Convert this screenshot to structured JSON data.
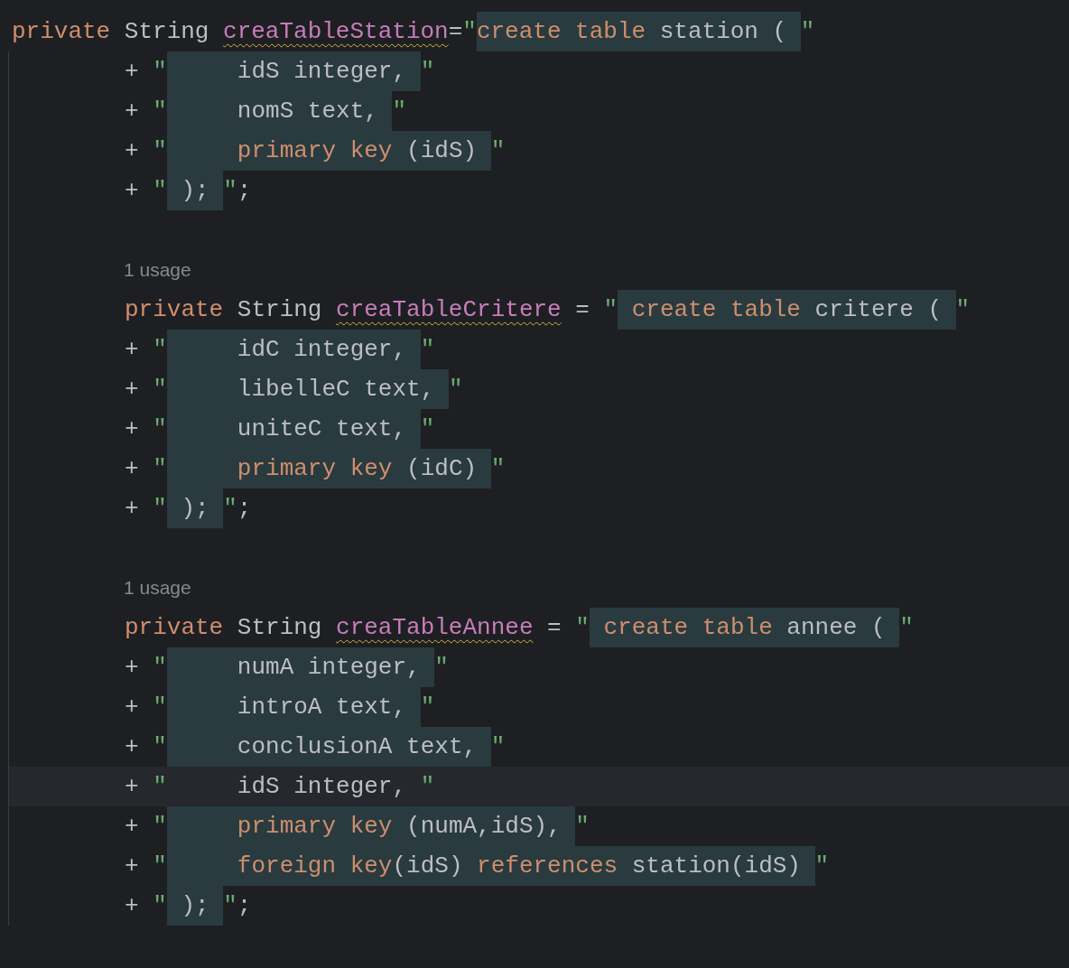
{
  "top_line": {
    "tokens": [
      {
        "text": "private",
        "kind": "keyword",
        "injected": false
      },
      {
        "text": " String ",
        "kind": "plain",
        "injected": false
      },
      {
        "text": "creaTableStation",
        "kind": "field",
        "warning": true,
        "injected": false
      },
      {
        "text": "=",
        "kind": "plain",
        "injected": false
      },
      {
        "text": "\"",
        "kind": "quote",
        "injected": false
      },
      {
        "text": "create table",
        "kind": "keyword",
        "injected": true
      },
      {
        "text": " station ( ",
        "kind": "plain",
        "injected": true
      },
      {
        "text": "\"",
        "kind": "quote",
        "injected": false
      }
    ]
  },
  "lines": [
    {
      "kind": "code",
      "tokens": [
        {
          "text": "+ ",
          "kind": "plain",
          "injected": false
        },
        {
          "text": "\"",
          "kind": "quote",
          "injected": false
        },
        {
          "text": "     idS integer, ",
          "kind": "plain",
          "injected": true
        },
        {
          "text": "\"",
          "kind": "quote",
          "injected": false
        }
      ]
    },
    {
      "kind": "code",
      "tokens": [
        {
          "text": "+ ",
          "kind": "plain",
          "injected": false
        },
        {
          "text": "\"",
          "kind": "quote",
          "injected": false
        },
        {
          "text": "     nomS text, ",
          "kind": "plain",
          "injected": true
        },
        {
          "text": "\"",
          "kind": "quote",
          "injected": false
        }
      ]
    },
    {
      "kind": "code",
      "tokens": [
        {
          "text": "+ ",
          "kind": "plain",
          "injected": false
        },
        {
          "text": "\"",
          "kind": "quote",
          "injected": false
        },
        {
          "text": "     primary key",
          "kind": "keyword",
          "injected": true
        },
        {
          "text": " (idS) ",
          "kind": "plain",
          "injected": true
        },
        {
          "text": "\"",
          "kind": "quote",
          "injected": false
        }
      ]
    },
    {
      "kind": "code",
      "tokens": [
        {
          "text": "+ ",
          "kind": "plain",
          "injected": false
        },
        {
          "text": "\"",
          "kind": "quote",
          "injected": false
        },
        {
          "text": " ); ",
          "kind": "plain",
          "injected": true
        },
        {
          "text": "\"",
          "kind": "quote",
          "injected": false
        },
        {
          "text": ";",
          "kind": "plain",
          "injected": false
        }
      ]
    },
    {
      "kind": "usage",
      "text": "1 usage"
    },
    {
      "kind": "code",
      "tokens": [
        {
          "text": "private",
          "kind": "keyword",
          "injected": false
        },
        {
          "text": " String ",
          "kind": "plain",
          "injected": false
        },
        {
          "text": "creaTableCritere",
          "kind": "field",
          "warning": true,
          "injected": false
        },
        {
          "text": " = ",
          "kind": "plain",
          "injected": false
        },
        {
          "text": "\"",
          "kind": "quote",
          "injected": false
        },
        {
          "text": " create table",
          "kind": "keyword",
          "injected": true
        },
        {
          "text": " critere ( ",
          "kind": "plain",
          "injected": true
        },
        {
          "text": "\"",
          "kind": "quote",
          "injected": false
        }
      ]
    },
    {
      "kind": "code",
      "tokens": [
        {
          "text": "+ ",
          "kind": "plain",
          "injected": false
        },
        {
          "text": "\"",
          "kind": "quote",
          "injected": false
        },
        {
          "text": "     idC integer, ",
          "kind": "plain",
          "injected": true
        },
        {
          "text": "\"",
          "kind": "quote",
          "injected": false
        }
      ]
    },
    {
      "kind": "code",
      "tokens": [
        {
          "text": "+ ",
          "kind": "plain",
          "injected": false
        },
        {
          "text": "\"",
          "kind": "quote",
          "injected": false
        },
        {
          "text": "     libelleC text, ",
          "kind": "plain",
          "injected": true
        },
        {
          "text": "\"",
          "kind": "quote",
          "injected": false
        }
      ]
    },
    {
      "kind": "code",
      "tokens": [
        {
          "text": "+ ",
          "kind": "plain",
          "injected": false
        },
        {
          "text": "\"",
          "kind": "quote",
          "injected": false
        },
        {
          "text": "     uniteC text, ",
          "kind": "plain",
          "injected": true
        },
        {
          "text": "\"",
          "kind": "quote",
          "injected": false
        }
      ]
    },
    {
      "kind": "code",
      "tokens": [
        {
          "text": "+ ",
          "kind": "plain",
          "injected": false
        },
        {
          "text": "\"",
          "kind": "quote",
          "injected": false
        },
        {
          "text": "     primary key",
          "kind": "keyword",
          "injected": true
        },
        {
          "text": " (idC) ",
          "kind": "plain",
          "injected": true
        },
        {
          "text": "\"",
          "kind": "quote",
          "injected": false
        }
      ]
    },
    {
      "kind": "code",
      "tokens": [
        {
          "text": "+ ",
          "kind": "plain",
          "injected": false
        },
        {
          "text": "\"",
          "kind": "quote",
          "injected": false
        },
        {
          "text": " ); ",
          "kind": "plain",
          "injected": true
        },
        {
          "text": "\"",
          "kind": "quote",
          "injected": false
        },
        {
          "text": ";",
          "kind": "plain",
          "injected": false
        }
      ]
    },
    {
      "kind": "usage",
      "text": "1 usage"
    },
    {
      "kind": "code",
      "tokens": [
        {
          "text": "private",
          "kind": "keyword",
          "injected": false
        },
        {
          "text": " String ",
          "kind": "plain",
          "injected": false
        },
        {
          "text": "creaTableAnnee",
          "kind": "field",
          "warning": true,
          "injected": false
        },
        {
          "text": " = ",
          "kind": "plain",
          "injected": false
        },
        {
          "text": "\"",
          "kind": "quote",
          "injected": false
        },
        {
          "text": " create table",
          "kind": "keyword",
          "injected": true
        },
        {
          "text": " annee ( ",
          "kind": "plain",
          "injected": true
        },
        {
          "text": "\"",
          "kind": "quote",
          "injected": false
        }
      ]
    },
    {
      "kind": "code",
      "tokens": [
        {
          "text": "+ ",
          "kind": "plain",
          "injected": false
        },
        {
          "text": "\"",
          "kind": "quote",
          "injected": false
        },
        {
          "text": "     numA integer, ",
          "kind": "plain",
          "injected": true
        },
        {
          "text": "\"",
          "kind": "quote",
          "injected": false
        }
      ]
    },
    {
      "kind": "code",
      "tokens": [
        {
          "text": "+ ",
          "kind": "plain",
          "injected": false
        },
        {
          "text": "\"",
          "kind": "quote",
          "injected": false
        },
        {
          "text": "     introA text, ",
          "kind": "plain",
          "injected": true
        },
        {
          "text": "\"",
          "kind": "quote",
          "injected": false
        }
      ]
    },
    {
      "kind": "code",
      "tokens": [
        {
          "text": "+ ",
          "kind": "plain",
          "injected": false
        },
        {
          "text": "\"",
          "kind": "quote",
          "injected": false
        },
        {
          "text": "     conclusionA text, ",
          "kind": "plain",
          "injected": true
        },
        {
          "text": "\"",
          "kind": "quote",
          "injected": false
        }
      ]
    },
    {
      "kind": "code",
      "current": true,
      "tokens": [
        {
          "text": "+ ",
          "kind": "plain",
          "injected": false
        },
        {
          "text": "\"",
          "kind": "quote",
          "injected": false
        },
        {
          "text": "     idS integer, ",
          "kind": "plain",
          "injected": false
        },
        {
          "text": "\"",
          "kind": "quote",
          "injected": false
        }
      ]
    },
    {
      "kind": "code",
      "tokens": [
        {
          "text": "+ ",
          "kind": "plain",
          "injected": false
        },
        {
          "text": "\"",
          "kind": "quote",
          "injected": false
        },
        {
          "text": "     primary key",
          "kind": "keyword",
          "injected": true
        },
        {
          "text": " (numA,idS), ",
          "kind": "plain",
          "injected": true
        },
        {
          "text": "\"",
          "kind": "quote",
          "injected": false
        }
      ]
    },
    {
      "kind": "code",
      "tokens": [
        {
          "text": "+ ",
          "kind": "plain",
          "injected": false
        },
        {
          "text": "\"",
          "kind": "quote",
          "injected": false
        },
        {
          "text": "     foreign key",
          "kind": "keyword",
          "injected": true
        },
        {
          "text": "(idS) ",
          "kind": "plain",
          "injected": true
        },
        {
          "text": "references",
          "kind": "keyword",
          "injected": true
        },
        {
          "text": " station(idS) ",
          "kind": "plain",
          "injected": true
        },
        {
          "text": "\"",
          "kind": "quote",
          "injected": false
        }
      ]
    },
    {
      "kind": "code",
      "tokens": [
        {
          "text": "+ ",
          "kind": "plain",
          "injected": false
        },
        {
          "text": "\"",
          "kind": "quote",
          "injected": false
        },
        {
          "text": " ); ",
          "kind": "plain",
          "injected": true
        },
        {
          "text": "\"",
          "kind": "quote",
          "injected": false
        },
        {
          "text": ";",
          "kind": "plain",
          "injected": false
        }
      ]
    }
  ]
}
